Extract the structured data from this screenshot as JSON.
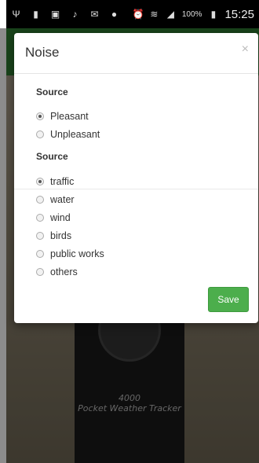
{
  "status_bar": {
    "left_icons": [
      "usb-icon",
      "sd-card-icon",
      "image-icon",
      "mic-icon",
      "mail-icon",
      "spotify-icon"
    ],
    "right_icons": [
      "alarm-icon",
      "wifi-icon",
      "signal-icon"
    ],
    "battery": "100%",
    "time": "15:25"
  },
  "background": {
    "device_label": "4000\nPocket Weather Tracker"
  },
  "dialog": {
    "title": "Noise",
    "close_label": "×",
    "sections": [
      {
        "label": "Source",
        "options": [
          {
            "label": "Pleasant",
            "checked": true
          },
          {
            "label": "Unpleasant",
            "checked": false
          }
        ]
      },
      {
        "label": "Source",
        "options": [
          {
            "label": "traffic",
            "checked": true
          },
          {
            "label": "water",
            "checked": false
          },
          {
            "label": "wind",
            "checked": false
          },
          {
            "label": "birds",
            "checked": false
          },
          {
            "label": "public works",
            "checked": false
          },
          {
            "label": "others",
            "checked": false
          }
        ]
      }
    ],
    "save_label": "Save"
  },
  "colors": {
    "app_bar": "#2e7d32",
    "save_button": "#4cae4c"
  }
}
